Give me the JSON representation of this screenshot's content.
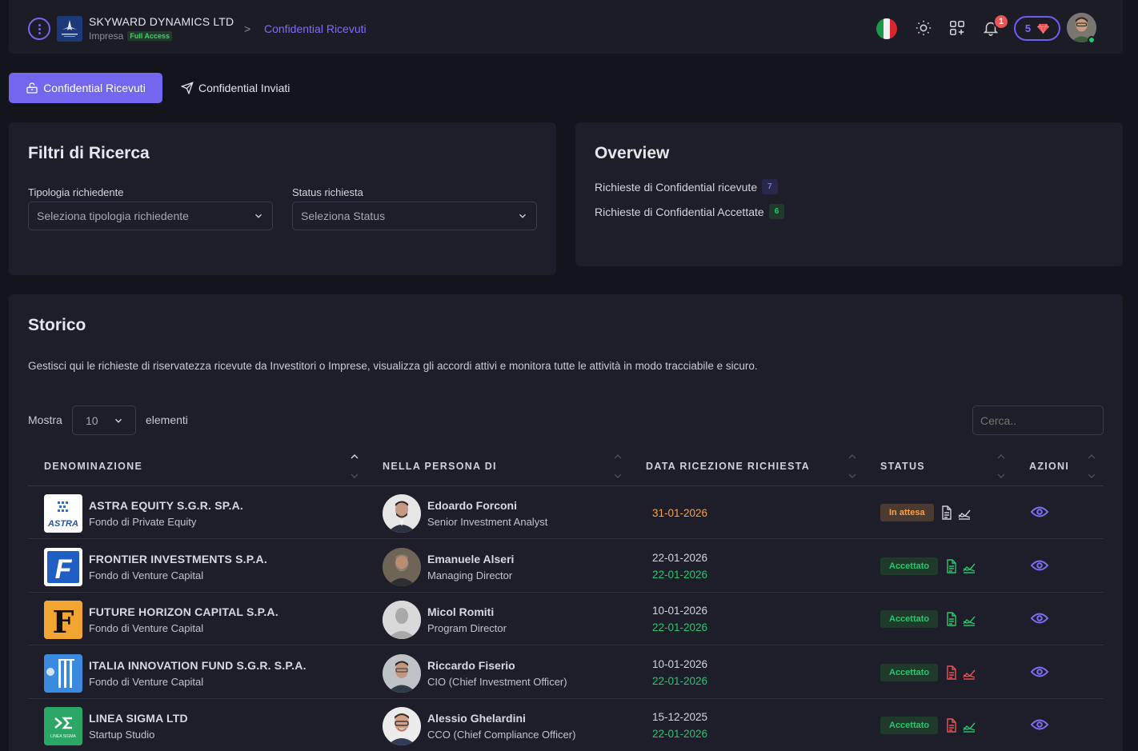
{
  "header": {
    "company_name": "SKYWARD DYNAMICS LTD",
    "company_type": "Impresa",
    "access_badge": "Full Access",
    "breadcrumb_sep": ">",
    "breadcrumb": "Confidential Ricevuti",
    "notifications_count": "1",
    "credits": "5",
    "flag": "italy-flag"
  },
  "tabs": [
    {
      "label": "Confidential Ricevuti",
      "active": true
    },
    {
      "label": "Confidential Inviati",
      "active": false
    }
  ],
  "filters": {
    "title": "Filtri di Ricerca",
    "tipologia_label": "Tipologia richiedente",
    "tipologia_placeholder": "Seleziona tipologia richiedente",
    "status_label": "Status richiesta",
    "status_placeholder": "Seleziona Status"
  },
  "overview": {
    "title": "Overview",
    "received_label": "Richieste di Confidential ricevute",
    "received_count": "7",
    "accepted_label": "Richieste di Confidential Accettate",
    "accepted_count": "6"
  },
  "storico": {
    "title": "Storico",
    "description": "Gestisci qui le richieste di riservatezza ricevute da Investitori o Imprese, visualizza gli accordi attivi e monitora tutte le attività in modo tracciabile e sicuro.",
    "show_label": "Mostra",
    "page_length": "10",
    "elements_label": "elementi",
    "search_placeholder": "Cerca..",
    "columns": [
      "DENOMINAZIONE",
      "NELLA PERSONA DI",
      "DATA RICEZIONE RICHIESTA",
      "STATUS",
      "AZIONI"
    ],
    "rows": [
      {
        "name": "ASTRA EQUITY S.G.R. SP.A.",
        "type": "Fondo di Private Equity",
        "person": "Edoardo Forconi",
        "role": "Senior Investment Analyst",
        "date": "31-01-2026",
        "date_accepted": "",
        "status": "In attesa"
      },
      {
        "name": "FRONTIER INVESTMENTS S.P.A.",
        "type": "Fondo di Venture Capital",
        "person": "Emanuele Alseri",
        "role": "Managing Director",
        "date": "22-01-2026",
        "date_accepted": "22-01-2026",
        "status": "Accettato"
      },
      {
        "name": "FUTURE HORIZON CAPITAL S.P.A.",
        "type": "Fondo di Venture Capital",
        "person": "Micol Romiti",
        "role": "Program Director",
        "date": "10-01-2026",
        "date_accepted": "22-01-2026",
        "status": "Accettato"
      },
      {
        "name": "ITALIA INNOVATION FUND S.G.R. S.P.A.",
        "type": "Fondo di Venture Capital",
        "person": "Riccardo Fiserio",
        "role": "CIO (Chief Investment Officer)",
        "date": "10-01-2026",
        "date_accepted": "22-01-2026",
        "status": "Accettato"
      },
      {
        "name": "LINEA SIGMA LTD",
        "type": "Startup Studio",
        "person": "Alessio Ghelardini",
        "role": "CCO (Chief Compliance Officer)",
        "date": "15-12-2025",
        "date_accepted": "22-01-2026",
        "status": "Accettato"
      }
    ],
    "logos": {
      "astra": "ASTRA",
      "frontier": "F",
      "future": "F",
      "sigma": "LINEA SIGMA"
    }
  },
  "colors": {
    "accent": "#7367f0",
    "success": "#28c76f",
    "warning": "#ff9f43",
    "danger": "#ea5455"
  }
}
